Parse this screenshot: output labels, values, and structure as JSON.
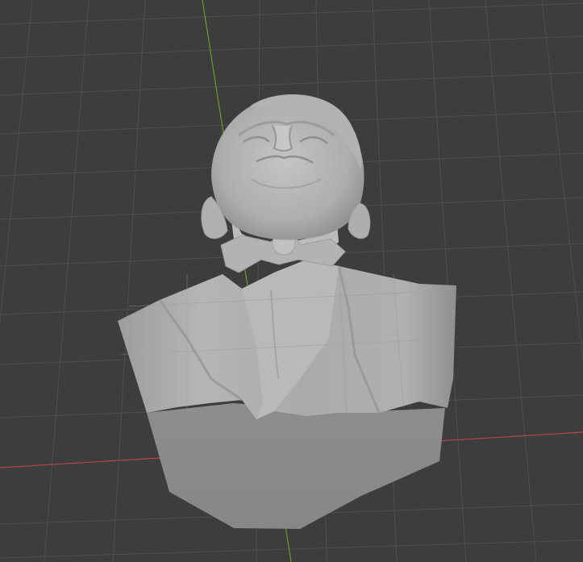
{
  "viewport": {
    "background_color": "#3d3d3d",
    "grid_color": "#4d4d4d",
    "x_axis_color": "#b5464b",
    "y_axis_color": "#6b9a2c",
    "grid_visible": true,
    "shading": "solid"
  },
  "model": {
    "object": "bust-sculpture",
    "surface_color": "#a7a7a7",
    "cap_color": "#8e8e8e"
  }
}
